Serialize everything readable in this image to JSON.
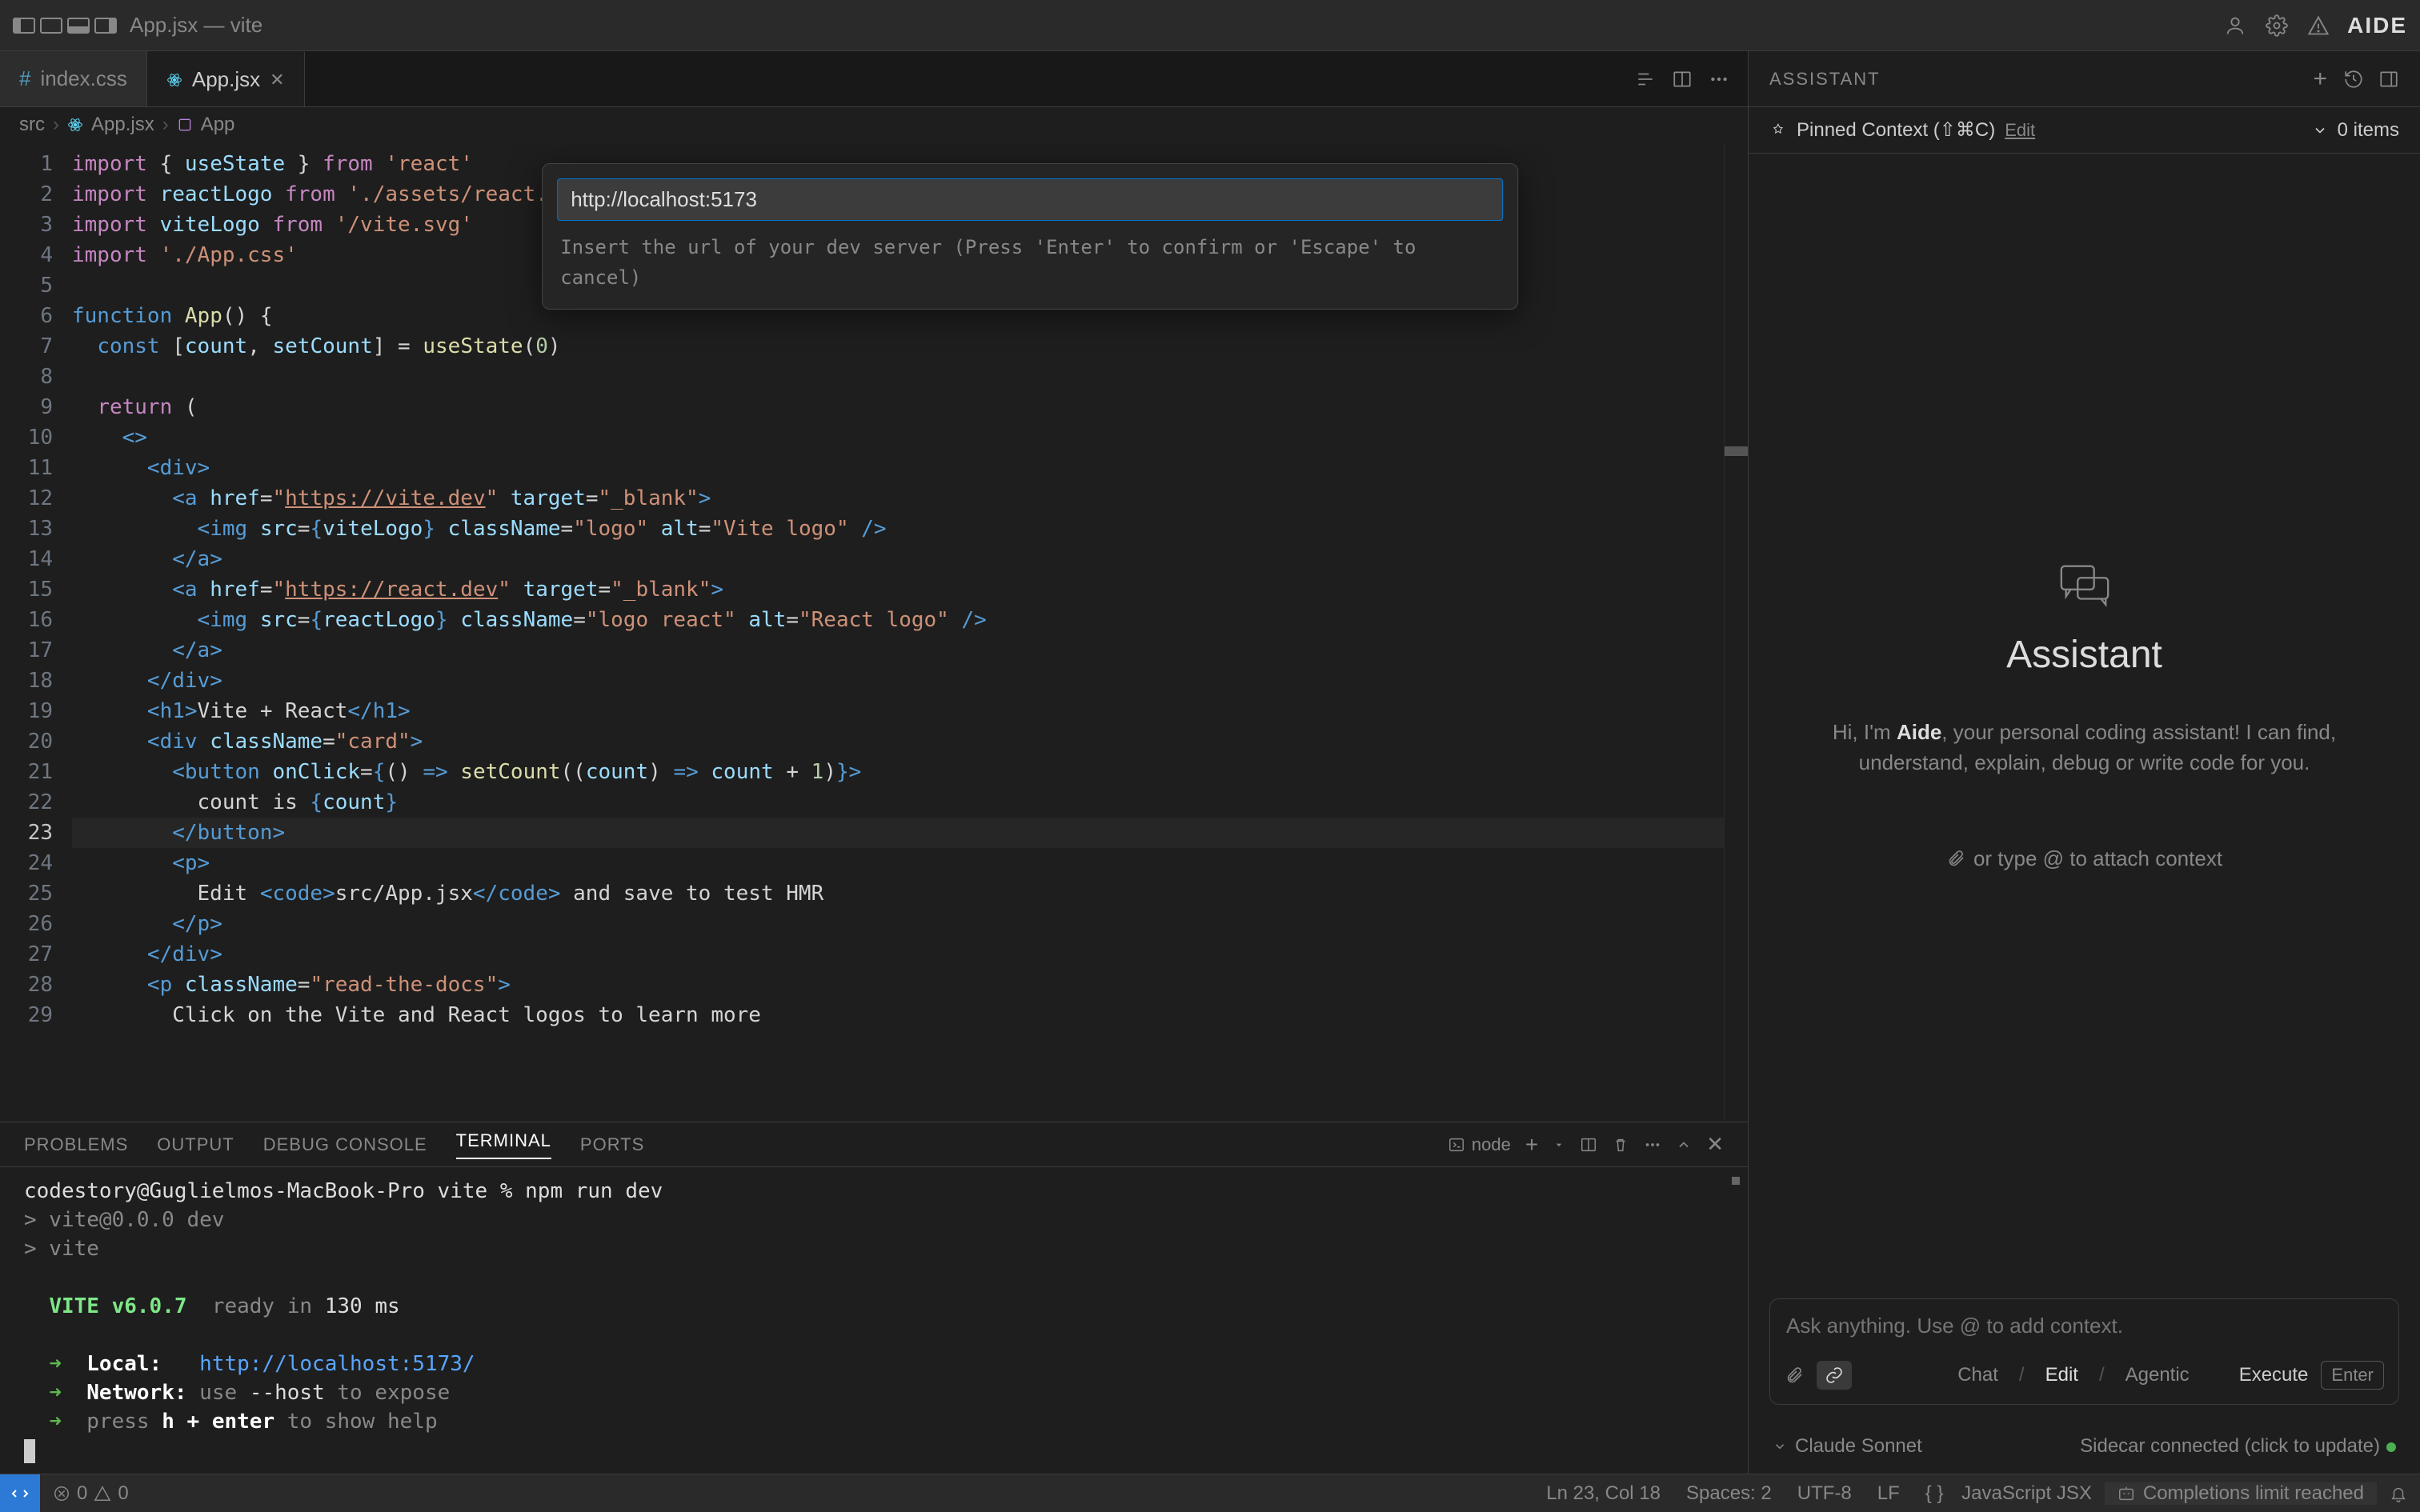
{
  "titlebar": {
    "window_title": "App.jsx — vite",
    "brand": "AIDE"
  },
  "tabs": [
    {
      "icon": "#",
      "label": "index.css",
      "active": false
    },
    {
      "icon": "⚛",
      "label": "App.jsx",
      "active": true
    }
  ],
  "breadcrumb": {
    "parts": [
      "src",
      "App.jsx",
      "App"
    ]
  },
  "editor": {
    "current_line": 23,
    "lines": [
      {
        "n": 1,
        "html": "<span class='kw'>import</span> { <span class='vr'>useState</span> } <span class='kw'>from</span> <span class='st'>'react'</span>"
      },
      {
        "n": 2,
        "html": "<span class='kw'>import</span> <span class='vr'>reactLogo</span> <span class='kw'>from</span> <span class='st'>'./assets/react.svg'</span>"
      },
      {
        "n": 3,
        "html": "<span class='kw'>import</span> <span class='vr'>viteLogo</span> <span class='kw'>from</span> <span class='st'>'/vite.svg'</span>"
      },
      {
        "n": 4,
        "html": "<span class='kw'>import</span> <span class='st'>'./App.css'</span>"
      },
      {
        "n": 5,
        "html": ""
      },
      {
        "n": 6,
        "html": "<span class='bl'>function</span> <span class='fn'>App</span>() {"
      },
      {
        "n": 7,
        "html": "  <span class='bl'>const</span> [<span class='vr'>count</span>, <span class='vr'>setCount</span>] = <span class='fn'>useState</span>(<span class='nm'>0</span>)"
      },
      {
        "n": 8,
        "html": ""
      },
      {
        "n": 9,
        "html": "  <span class='kw'>return</span> ("
      },
      {
        "n": 10,
        "html": "    <span class='tag'>&lt;&gt;</span>"
      },
      {
        "n": 11,
        "html": "      <span class='tag'>&lt;div&gt;</span>"
      },
      {
        "n": 12,
        "html": "        <span class='tag'>&lt;a</span> <span class='attr'>href</span>=<span class='st'>\"<span class='underline'>https://vite.dev</span>\"</span> <span class='attr'>target</span>=<span class='st'>\"_blank\"</span><span class='tag'>&gt;</span>"
      },
      {
        "n": 13,
        "html": "          <span class='tag'>&lt;img</span> <span class='attr'>src</span>=<span class='bl'>{</span><span class='vr'>viteLogo</span><span class='bl'>}</span> <span class='attr'>className</span>=<span class='st'>\"logo\"</span> <span class='attr'>alt</span>=<span class='st'>\"Vite logo\"</span> <span class='tag'>/&gt;</span>"
      },
      {
        "n": 14,
        "html": "        <span class='tag'>&lt;/a&gt;</span>"
      },
      {
        "n": 15,
        "html": "        <span class='tag'>&lt;a</span> <span class='attr'>href</span>=<span class='st'>\"<span class='underline'>https://react.dev</span>\"</span> <span class='attr'>target</span>=<span class='st'>\"_blank\"</span><span class='tag'>&gt;</span>"
      },
      {
        "n": 16,
        "html": "          <span class='tag'>&lt;img</span> <span class='attr'>src</span>=<span class='bl'>{</span><span class='vr'>reactLogo</span><span class='bl'>}</span> <span class='attr'>className</span>=<span class='st'>\"logo react\"</span> <span class='attr'>alt</span>=<span class='st'>\"React logo\"</span> <span class='tag'>/&gt;</span>"
      },
      {
        "n": 17,
        "html": "        <span class='tag'>&lt;/a&gt;</span>"
      },
      {
        "n": 18,
        "html": "      <span class='tag'>&lt;/div&gt;</span>"
      },
      {
        "n": 19,
        "html": "      <span class='tag'>&lt;h1&gt;</span>Vite + React<span class='tag'>&lt;/h1&gt;</span>"
      },
      {
        "n": 20,
        "html": "      <span class='tag'>&lt;div</span> <span class='attr'>className</span>=<span class='st'>\"card\"</span><span class='tag'>&gt;</span>"
      },
      {
        "n": 21,
        "html": "        <span class='tag'>&lt;button</span> <span class='attr'>onClick</span>=<span class='bl'>{</span>() <span class='bl'>=&gt;</span> <span class='fn'>setCount</span>((<span class='vr'>count</span>) <span class='bl'>=&gt;</span> <span class='vr'>count</span> + <span class='nm'>1</span>)<span class='bl'>}</span><span class='tag'>&gt;</span>"
      },
      {
        "n": 22,
        "html": "          count is <span class='bl'>{</span><span class='vr'>count</span><span class='bl'>}</span>"
      },
      {
        "n": 23,
        "html": "        <span class='tag'>&lt;/button&gt;</span>"
      },
      {
        "n": 24,
        "html": "        <span class='tag'>&lt;p&gt;</span>"
      },
      {
        "n": 25,
        "html": "          Edit <span class='tag'>&lt;code&gt;</span>src/App.jsx<span class='tag'>&lt;/code&gt;</span> and save to test HMR"
      },
      {
        "n": 26,
        "html": "        <span class='tag'>&lt;/p&gt;</span>"
      },
      {
        "n": 27,
        "html": "      <span class='tag'>&lt;/div&gt;</span>"
      },
      {
        "n": 28,
        "html": "      <span class='tag'>&lt;p</span> <span class='attr'>className</span>=<span class='st'>\"read-the-docs\"</span><span class='tag'>&gt;</span>"
      },
      {
        "n": 29,
        "html": "        Click on the Vite and React logos to learn more"
      }
    ]
  },
  "quick_input": {
    "value": "http://localhost:5173",
    "hint": "Insert the url of your dev server (Press 'Enter' to confirm or 'Escape' to cancel)"
  },
  "panel": {
    "tabs": [
      "PROBLEMS",
      "OUTPUT",
      "DEBUG CONSOLE",
      "TERMINAL",
      "PORTS"
    ],
    "active_tab": "TERMINAL",
    "terminal_name": "node",
    "terminal": {
      "prompt": "codestory@Guglielmos-MacBook-Pro vite % npm run dev",
      "line2": "> vite@0.0.0 dev",
      "line3": "> vite",
      "vite_version": "VITE v6.0.7",
      "ready": "ready in",
      "ready_ms": "130 ms",
      "local_label": "Local:",
      "local_url": "http://localhost:5173/",
      "network_label": "Network:",
      "network_hint": "use --host to expose",
      "network_use": "use",
      "network_flag": "--host",
      "network_rest": "to expose",
      "help_hint": "press",
      "help_key": "h + enter",
      "help_rest": "to show help"
    }
  },
  "assistant": {
    "header": "ASSISTANT",
    "context_label": "Pinned Context (⇧⌘C)",
    "edit_label": "Edit",
    "items_count": "0 items",
    "title": "Assistant",
    "greeting_prefix": "Hi, I'm ",
    "greeting_name": "Aide",
    "greeting_suffix": ", your personal coding assistant! I can find, understand, explain, debug or write code for you.",
    "attach_hint": "or type @ to attach context",
    "input_placeholder": "Ask anything. Use @ to add context.",
    "modes": [
      "Chat",
      "Edit",
      "Agentic"
    ],
    "execute_label": "Execute",
    "enter_label": "Enter",
    "model": "Claude Sonnet",
    "sidecar": "Sidecar connected (click to update)"
  },
  "status": {
    "errors": "0",
    "warnings": "0",
    "cursor": "Ln 23, Col 18",
    "spaces": "Spaces: 2",
    "encoding": "UTF-8",
    "eol": "LF",
    "language": "JavaScript JSX",
    "completion": "Completions limit reached"
  }
}
